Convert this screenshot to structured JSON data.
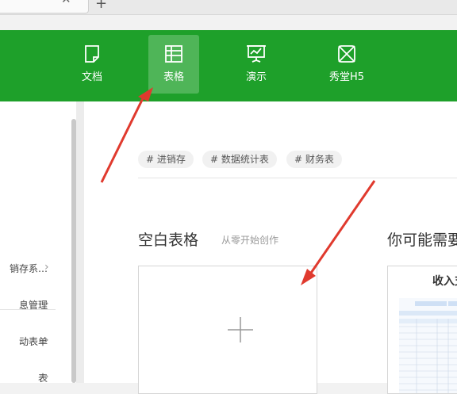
{
  "browser": {
    "tab_close_icon": "close-icon",
    "new_tab_icon": "plus-icon"
  },
  "header": {
    "background": "#1ea02a",
    "nav": [
      {
        "label": "文档",
        "icon": "document-icon",
        "active": false
      },
      {
        "label": "表格",
        "icon": "spreadsheet-icon",
        "active": true
      },
      {
        "label": "演示",
        "icon": "presentation-icon",
        "active": false
      },
      {
        "label": "秀堂H5",
        "icon": "h5-icon",
        "active": false
      }
    ]
  },
  "sidebar": {
    "items": [
      {
        "label": "销存系…"
      },
      {
        "label": "息管理"
      },
      {
        "label": "动表单"
      },
      {
        "label": "表"
      }
    ]
  },
  "main": {
    "tags": [
      "# 进销存",
      "# 数据统计表",
      "# 财务表"
    ],
    "blank": {
      "title": "空白表格",
      "subtitle": "从零开始创作"
    },
    "suggest": {
      "title": "你可能需要"
    },
    "template_card": {
      "title": "收入支"
    }
  },
  "annotation_color": "#e03a2e"
}
